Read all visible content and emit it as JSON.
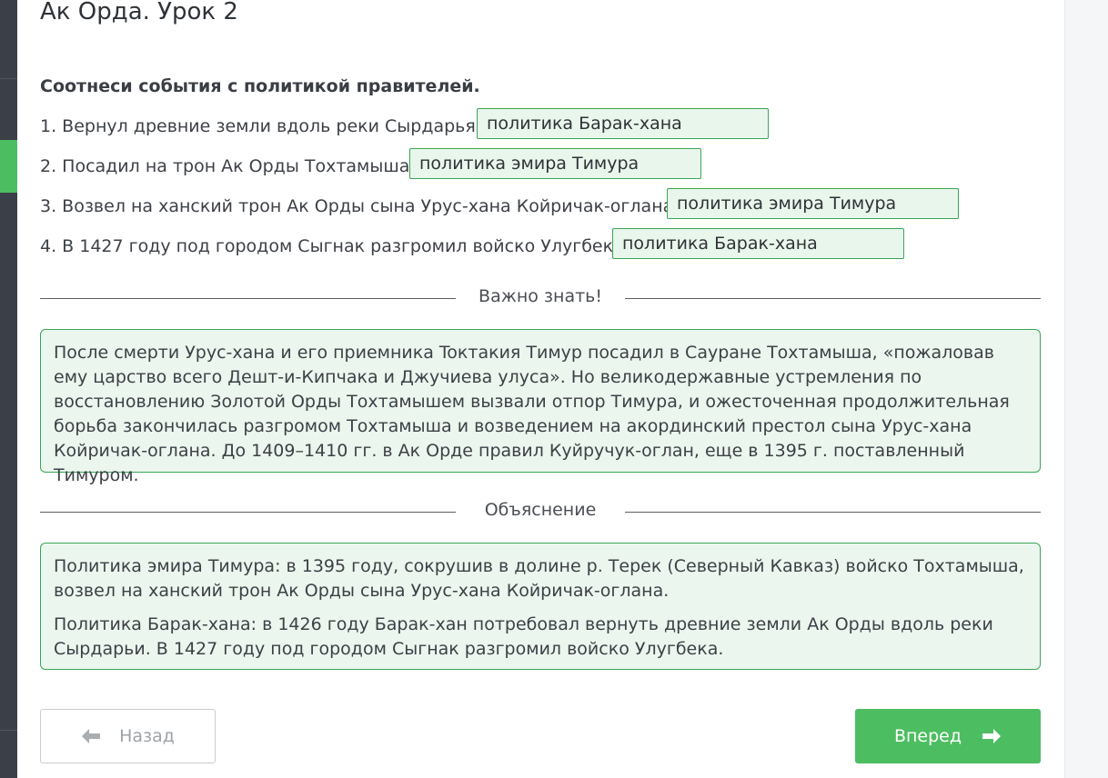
{
  "lesson": {
    "title": "Ак Орда. Урок 2"
  },
  "task": {
    "instruction": "Соотнеси события с политикой правителей.",
    "items": [
      {
        "question": "1. Вернул древние земли вдоль реки Сырдарья.",
        "answer": "политика Барак-хана"
      },
      {
        "question": "2. Посадил на трон Ак Орды Тохтамыша.",
        "answer": "политика эмира Тимура"
      },
      {
        "question": "3. Возвел на ханский трон Ак Орды сына Урус-хана Койричак-оглана.",
        "answer": "политика эмира Тимура"
      },
      {
        "question": "4. В 1427 году под городом Сыгнак разгромил войско Улугбека.",
        "answer": "политика Барак-хана"
      }
    ]
  },
  "important": {
    "heading": "Важно знать!",
    "text": "После смерти Урус-хана и его приемника Toктакия Тимур посадил в Сауране Тохтамыша, «пожаловав ему царство всего Дешт-и-Кипчака и Джучиева улуса». Но великодержавные устремления по восстановлению Золотой Орды Тохтамышем вызвали отпор Тимура, и ожесточенная продолжительная борьба закончилась разгромом Тохтамыша и возведением на акординский престол сына Урус-хана Койричак-оглана. До 1409–1410 гг. в Ак Орде правил Куйручук-оглан, еще в 1395 г. поставленный Тимуром."
  },
  "explanation": {
    "heading": "Объяснение",
    "paragraphs": [
      "Политика эмира Тимура: в 1395 году, сокрушив в долине р. Терек (Северный Кавказ) войско Тохтамыша, возвел на ханский трон Ак Орды сына Урус-хана Койричак-оглана.",
      "Политика Барак-хана: в 1426 году Барак-хан потребовал вернуть древние земли Ак Орды вдоль реки Сырдарьи. В 1427 году под городом Сыгнак разгромил войско Улугбека."
    ]
  },
  "navigation": {
    "back_label": "Назад",
    "next_label": "Вперед"
  },
  "icons": {
    "back": "arrow-left-icon",
    "next": "arrow-right-icon"
  },
  "colors": {
    "accent": "#4dbd61",
    "answer_border": "#3aa556",
    "answer_bg": "#e9f6ec"
  }
}
